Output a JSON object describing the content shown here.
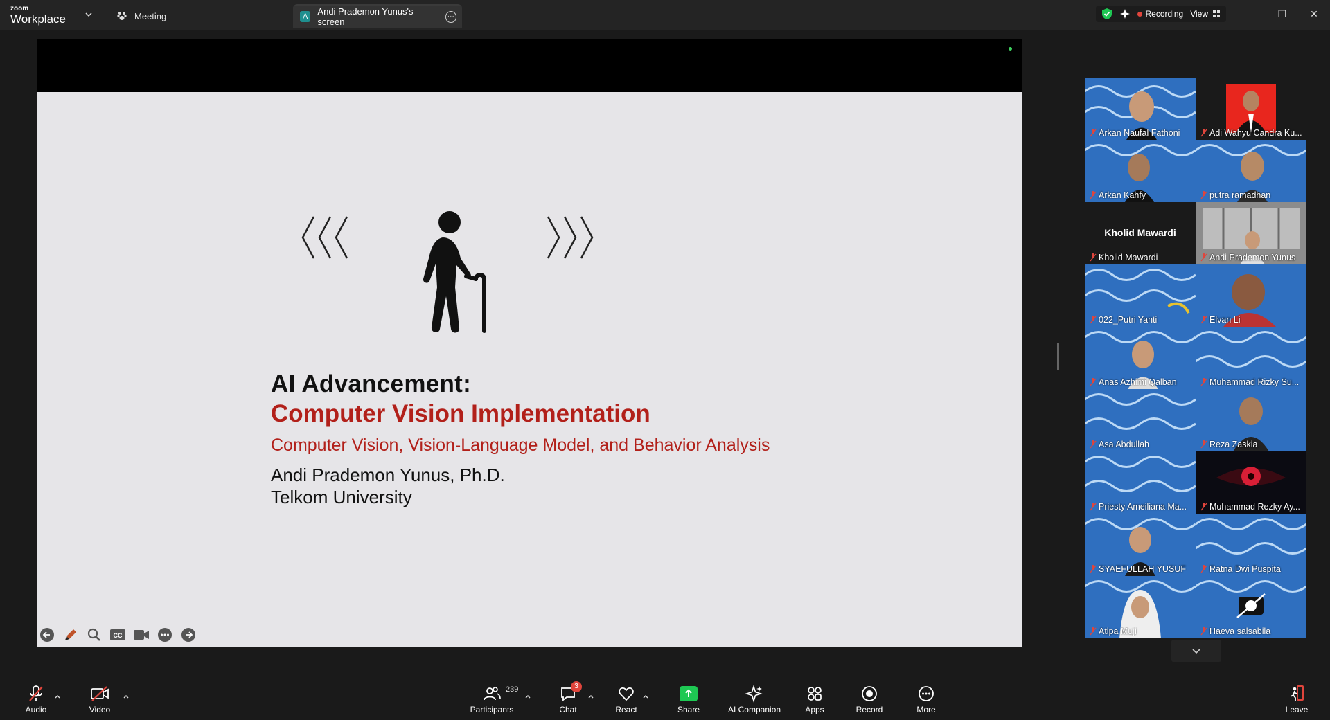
{
  "app": {
    "logo_top": "zoom",
    "logo_bottom": "Workplace",
    "meeting_label": "Meeting",
    "share_tab_avatar": "A",
    "share_tab_title": "Andi Pradem​on Yunus's screen",
    "recording_label": "Recording",
    "view_label": "View"
  },
  "slide": {
    "title": "AI Advancement:",
    "subtitle_red": "Computer Vision Implementation",
    "topics": "Computer Vision, Vision-Language Model, and Behavior Analysis",
    "author": "Andi Prademon Yunus, Ph.D.",
    "affiliation": "Telkom University"
  },
  "gallery": {
    "participants": [
      {
        "name": "Arkan Naufal Fathoni"
      },
      {
        "name": "Adi Wahyu Candra Ku..."
      },
      {
        "name": "Arkan Kahfy"
      },
      {
        "name": "putra ramadhan"
      },
      {
        "name": "Kholid Mawardi",
        "big_name": "Kholid Mawardi"
      },
      {
        "name": "Andi Prademon Yunus"
      },
      {
        "name": "022_Putri Yanti"
      },
      {
        "name": "Elvan Li"
      },
      {
        "name": "Anas Azhimi Qalban"
      },
      {
        "name": "Muhammad Rizky Su..."
      },
      {
        "name": "Asa Abdullah"
      },
      {
        "name": "Reza Zaskia"
      },
      {
        "name": "Priesty Ameiliana Ma..."
      },
      {
        "name": "Muhammad Rezky Ay..."
      },
      {
        "name": "SYAEFULLAH YUSUF"
      },
      {
        "name": "Ratna Dwi Puspita"
      },
      {
        "name": "Atipa Muji"
      },
      {
        "name": "Haeva salsabila"
      }
    ]
  },
  "toolbar": {
    "audio": "Audio",
    "video": "Video",
    "participants": "Participants",
    "participants_count": "239",
    "chat": "Chat",
    "chat_badge": "3",
    "react": "React",
    "share": "Share",
    "ai_companion": "AI Companion",
    "apps": "Apps",
    "record": "Record",
    "more": "More",
    "leave": "Leave"
  },
  "colors": {
    "accent_green": "#1ec853",
    "brand_red": "#b2201a",
    "recording_red": "#e0453c"
  }
}
